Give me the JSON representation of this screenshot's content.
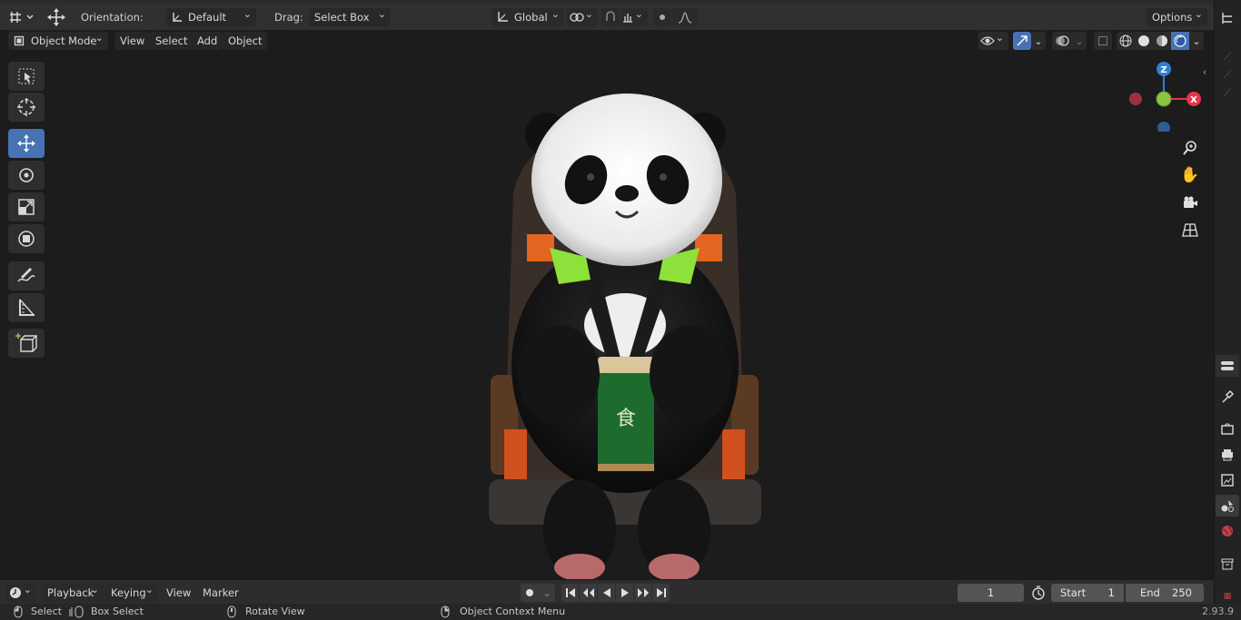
{
  "header": {
    "orientation_label": "Orientation:",
    "orientation_value": "Default",
    "drag_label": "Drag:",
    "drag_value": "Select Box",
    "transform_space": "Global",
    "options_label": "Options"
  },
  "viewport_header": {
    "mode": "Object Mode",
    "menus": [
      "View",
      "Select",
      "Add",
      "Object"
    ]
  },
  "toolbar": {
    "tools": [
      "select-box",
      "cursor",
      "move",
      "rotate",
      "scale",
      "transform",
      "annotate",
      "measure",
      "add-cube"
    ],
    "active_tool": "move"
  },
  "gizmo": {
    "z": "Z",
    "x": "X"
  },
  "timeline": {
    "menus": [
      "Playback",
      "Keying",
      "View",
      "Marker"
    ],
    "current_frame": "1",
    "start_label": "Start",
    "start_value": "1",
    "end_label": "End",
    "end_value": "250"
  },
  "statusbar": {
    "left_click": "Select",
    "left_drag": "Box Select",
    "middle": "Rotate View",
    "right": "Object Context Menu",
    "version": "2.93.9"
  },
  "colors": {
    "accent": "#4772b3",
    "axis_x": "#e8354a",
    "axis_y": "#8bc53f",
    "axis_z": "#2f7fd6"
  }
}
